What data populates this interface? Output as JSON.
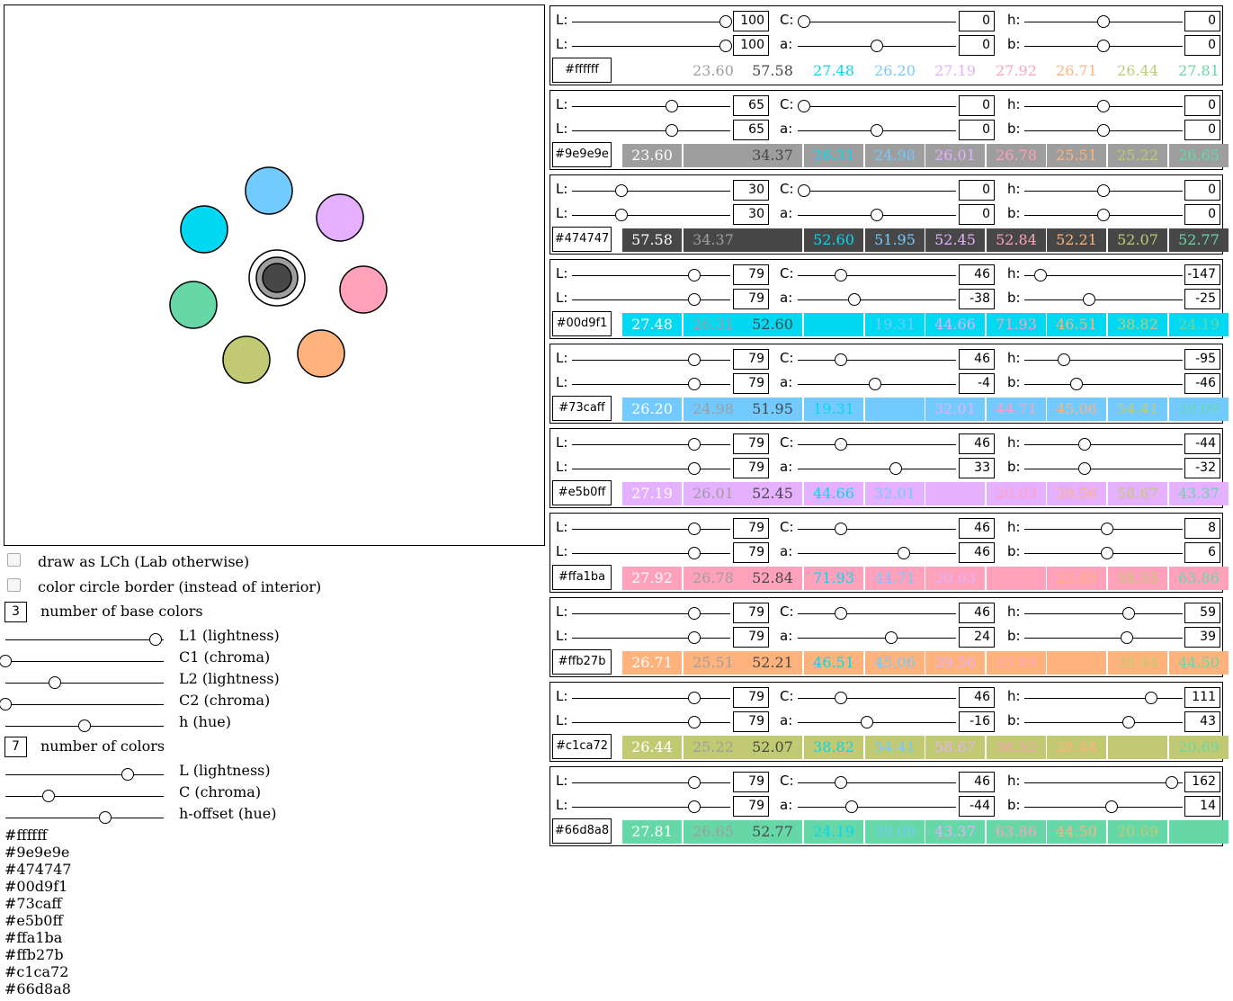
{
  "controls": {
    "draw_as_lch": "draw as LCh (Lab otherwise)",
    "circle_border": "color circle border (instead of interior)",
    "num_base_colors": "3",
    "num_base_colors_label": "number of base colors",
    "L1_label": "L1 (lightness)",
    "C1_label": "C1 (chroma)",
    "L2_label": "L2 (lightness)",
    "C2_label": "C2 (chroma)",
    "h_label": "h (hue)",
    "num_colors": "7",
    "num_colors_label": "number of colors",
    "L_label": "L (lightness)",
    "C_label": "C (chroma)",
    "hoffset_label": "h-offset (hue)",
    "slider_levels": {
      "L1": 0.95,
      "C1": 0.0,
      "L2": 0.31,
      "C2": 0.0,
      "h": 0.5,
      "L": 0.77,
      "C": 0.27,
      "hoffset": 0.63
    }
  },
  "hex_list": [
    "#ffffff",
    "#9e9e9e",
    "#474747",
    "#00d9f1",
    "#73caff",
    "#e5b0ff",
    "#ffa1ba",
    "#ffb27b",
    "#c1ca72",
    "#66d8a8"
  ],
  "circles": [
    {
      "color": "#73caff"
    },
    {
      "color": "#e5b0ff"
    },
    {
      "color": "#00d9f1"
    },
    {
      "color": "#ffa1ba"
    },
    {
      "color": "#66d8a8"
    },
    {
      "color": "#ffb27b"
    },
    {
      "color": "#c1ca72"
    }
  ],
  "center": {
    "outer": "#ffffff",
    "middle": "#9e9e9e",
    "inner": "#474747"
  },
  "labels": {
    "L": "L:",
    "C": "C:",
    "h": "h:",
    "a": "a:",
    "b": "b:"
  },
  "panels": [
    {
      "hex": "#ffffff",
      "color": "#ffffff",
      "L": "100",
      "C": "0",
      "h": "0",
      "a": "0",
      "b": "0",
      "levels": {
        "L": 0.97,
        "C": 0.04,
        "h": 0.5,
        "L2": 0.97,
        "a": 0.5,
        "b": 0.5
      },
      "cells": [
        "23.60",
        "57.58",
        "27.48",
        "26.20",
        "27.19",
        "27.92",
        "26.71",
        "26.44",
        "27.81"
      ]
    },
    {
      "hex": "#9e9e9e",
      "color": "#9e9e9e",
      "L": "65",
      "C": "0",
      "h": "0",
      "a": "0",
      "b": "0",
      "levels": {
        "L": 0.63,
        "C": 0.04,
        "h": 0.5,
        "L2": 0.63,
        "a": 0.5,
        "b": 0.5
      },
      "cells": [
        "23.60",
        "",
        "34.37",
        "26.31",
        "24.98",
        "26.01",
        "26.78",
        "25.51",
        "25.22",
        "26.65"
      ]
    },
    {
      "hex": "#474747",
      "color": "#474747",
      "L": "30",
      "C": "0",
      "h": "0",
      "a": "0",
      "b": "0",
      "levels": {
        "L": 0.31,
        "C": 0.04,
        "h": 0.5,
        "L2": 0.31,
        "a": 0.5,
        "b": 0.5
      },
      "cells": [
        "57.58",
        "34.37",
        "",
        "52.60",
        "51.95",
        "52.45",
        "52.84",
        "52.21",
        "52.07",
        "52.77"
      ]
    },
    {
      "hex": "#00d9f1",
      "color": "#00d9f1",
      "L": "79",
      "C": "46",
      "h": "-147",
      "a": "-38",
      "b": "-25",
      "levels": {
        "L": 0.77,
        "C": 0.27,
        "h": 0.1,
        "L2": 0.77,
        "a": 0.36,
        "b": 0.41
      },
      "cells": [
        "27.48",
        "26.31",
        "52.60",
        "",
        "19.31",
        "44.66",
        "71.93",
        "46.51",
        "38.82",
        "24.19"
      ]
    },
    {
      "hex": "#73caff",
      "color": "#73caff",
      "L": "79",
      "C": "46",
      "h": "-95",
      "a": "-4",
      "b": "-46",
      "levels": {
        "L": 0.77,
        "C": 0.27,
        "h": 0.25,
        "L2": 0.77,
        "a": 0.49,
        "b": 0.33
      },
      "cells": [
        "26.20",
        "24.98",
        "51.95",
        "19.31",
        "",
        "32.01",
        "44.71",
        "45.06",
        "54.41",
        "39.09"
      ]
    },
    {
      "hex": "#e5b0ff",
      "color": "#e5b0ff",
      "L": "79",
      "C": "46",
      "h": "-44",
      "a": "33",
      "b": "-32",
      "levels": {
        "L": 0.77,
        "C": 0.27,
        "h": 0.38,
        "L2": 0.77,
        "a": 0.62,
        "b": 0.38
      },
      "cells": [
        "27.19",
        "26.01",
        "52.45",
        "44.66",
        "32.01",
        "",
        "20.03",
        "39.56",
        "58.67",
        "43.37"
      ]
    },
    {
      "hex": "#ffa1ba",
      "color": "#ffa1ba",
      "L": "79",
      "C": "46",
      "h": "8",
      "a": "46",
      "b": "6",
      "levels": {
        "L": 0.77,
        "C": 0.27,
        "h": 0.52,
        "L2": 0.77,
        "a": 0.67,
        "b": 0.52
      },
      "cells": [
        "27.92",
        "26.78",
        "52.84",
        "71.93",
        "44.71",
        "20.03",
        "",
        "23.89",
        "58.55",
        "63.86"
      ]
    },
    {
      "hex": "#ffb27b",
      "color": "#ffb27b",
      "L": "79",
      "C": "46",
      "h": "59",
      "a": "24",
      "b": "39",
      "levels": {
        "L": 0.77,
        "C": 0.27,
        "h": 0.66,
        "L2": 0.77,
        "a": 0.59,
        "b": 0.65
      },
      "cells": [
        "26.71",
        "25.51",
        "52.21",
        "46.51",
        "45.06",
        "39.56",
        "23.89",
        "",
        "28.44",
        "44.50"
      ]
    },
    {
      "hex": "#c1ca72",
      "color": "#c1ca72",
      "L": "79",
      "C": "46",
      "h": "111",
      "a": "-16",
      "b": "43",
      "levels": {
        "L": 0.77,
        "C": 0.27,
        "h": 0.8,
        "L2": 0.77,
        "a": 0.44,
        "b": 0.66
      },
      "cells": [
        "26.44",
        "25.22",
        "52.07",
        "38.82",
        "54.41",
        "58.67",
        "58.55",
        "28.44",
        "",
        "20.69"
      ]
    },
    {
      "hex": "#66d8a8",
      "color": "#66d8a8",
      "L": "79",
      "C": "46",
      "h": "162",
      "a": "-44",
      "b": "14",
      "levels": {
        "L": 0.77,
        "C": 0.27,
        "h": 0.93,
        "L2": 0.77,
        "a": 0.34,
        "b": 0.55
      },
      "cells": [
        "27.81",
        "26.65",
        "52.77",
        "24.19",
        "39.09",
        "43.37",
        "63.86",
        "44.50",
        "20.69",
        ""
      ]
    }
  ]
}
